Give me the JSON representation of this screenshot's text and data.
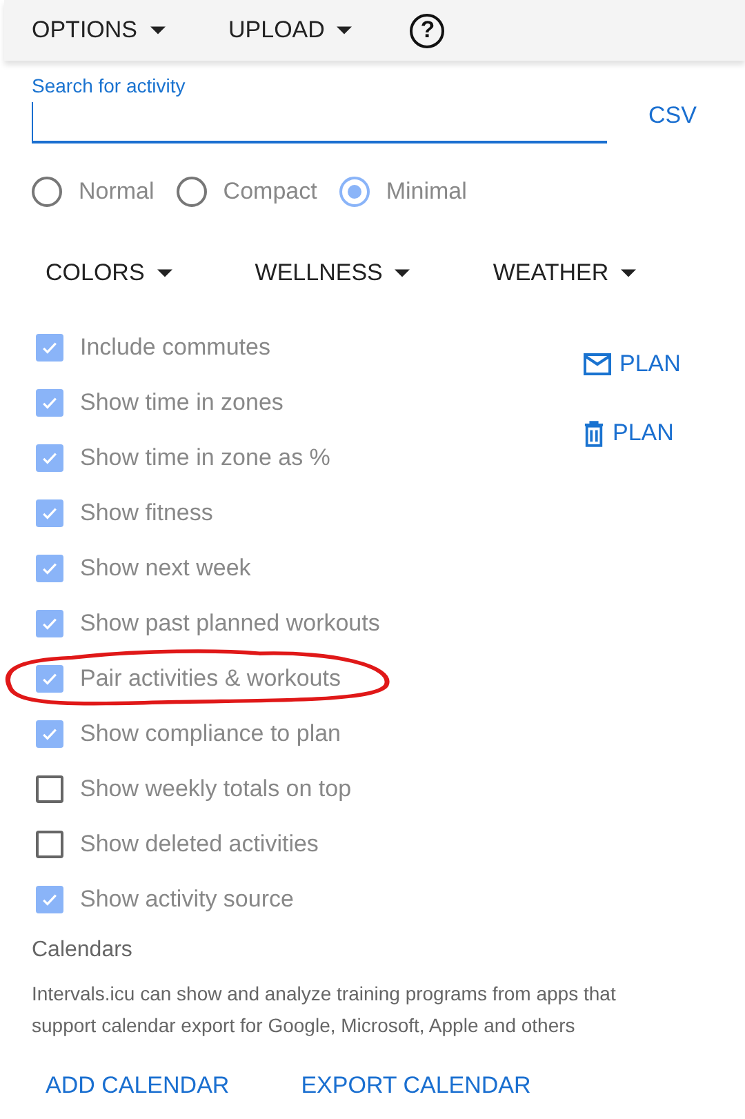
{
  "toolbar": {
    "menus": [
      {
        "label": "OPTIONS"
      },
      {
        "label": "UPLOAD"
      }
    ],
    "help": "?"
  },
  "search": {
    "label": "Search for activity",
    "csv": "CSV"
  },
  "layouts": [
    {
      "label": "Normal",
      "selected": false
    },
    {
      "label": "Compact",
      "selected": false
    },
    {
      "label": "Minimal",
      "selected": true
    }
  ],
  "dropdowns": [
    {
      "label": "COLORS"
    },
    {
      "label": "WELLNESS"
    },
    {
      "label": "WEATHER"
    }
  ],
  "options": [
    {
      "label": "Include commutes",
      "checked": true,
      "circled": false
    },
    {
      "label": "Show time in zones",
      "checked": true,
      "circled": false
    },
    {
      "label": "Show time in zone as %",
      "checked": true,
      "circled": false
    },
    {
      "label": "Show fitness",
      "checked": true,
      "circled": false
    },
    {
      "label": "Show next week",
      "checked": true,
      "circled": false
    },
    {
      "label": "Show past planned workouts",
      "checked": true,
      "circled": false
    },
    {
      "label": "Pair activities & workouts",
      "checked": true,
      "circled": true
    },
    {
      "label": "Show compliance to plan",
      "checked": true,
      "circled": false
    },
    {
      "label": "Show weekly totals on top",
      "checked": false,
      "circled": false
    },
    {
      "label": "Show deleted activities",
      "checked": false,
      "circled": false
    },
    {
      "label": "Show activity source",
      "checked": true,
      "circled": false
    }
  ],
  "plan_buttons": [
    {
      "kind": "email",
      "label": "PLAN"
    },
    {
      "kind": "delete",
      "label": "PLAN"
    }
  ],
  "calendars": {
    "heading": "Calendars",
    "text": "Intervals.icu can show and analyze training programs from apps that support calendar export for Google, Microsoft, Apple and others",
    "buttons": [
      "ADD CALENDAR",
      "EXPORT CALENDAR"
    ]
  }
}
